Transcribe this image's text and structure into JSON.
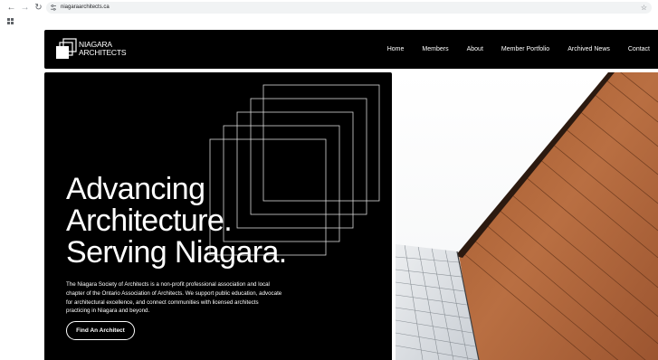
{
  "browser": {
    "url": "niagaraarchitects.ca",
    "back_icon": "arrow-left-icon",
    "forward_icon": "arrow-right-icon",
    "reload_icon": "reload-icon",
    "bookmark_icon": "star-icon",
    "apps_icon": "apps-grid-icon"
  },
  "site": {
    "logo": {
      "line1": "NIAGARA",
      "line2": "ARCHITECTS"
    },
    "nav": [
      "Home",
      "Members",
      "About",
      "Member Portfolio",
      "Archived News",
      "Contact"
    ]
  },
  "hero": {
    "headline": [
      "Advancing",
      "Architecture.",
      "Serving Niagara."
    ],
    "description": "The Niagara Society of Architects is a non-profit professional association and local chapter of the Ontario Association of Architects. We support public education, advocate for architectural excellence, and connect communities with licensed architects practicing in Niagara and beyond.",
    "cta_label": "Find An Architect"
  },
  "colors": {
    "header_bg": "#000000",
    "hero_bg": "#000000",
    "text_on_dark": "#ffffff",
    "photo_wood": "#b56a3c",
    "photo_panel": "#d9dde2"
  }
}
